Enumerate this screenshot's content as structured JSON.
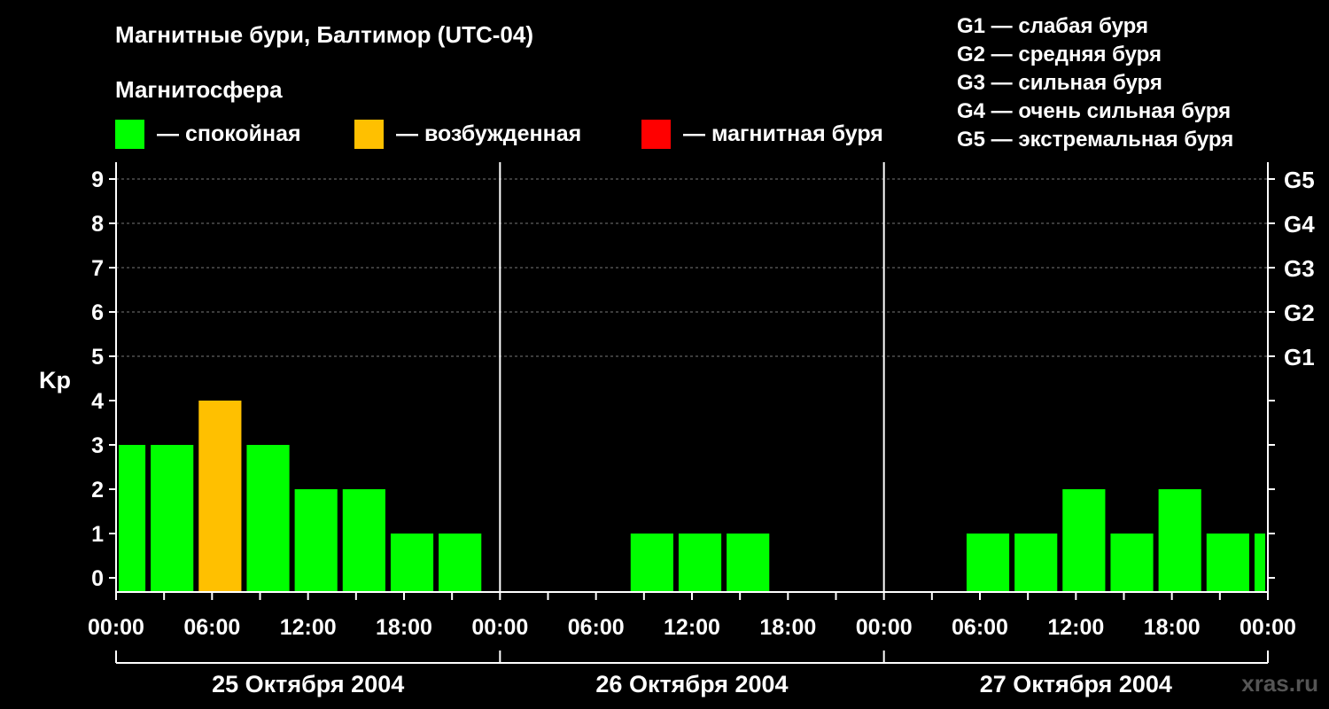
{
  "title": "Магнитные бури, Балтимор (UTC-04)",
  "subtitle": "Магнитосфера",
  "legend": [
    {
      "label": "— спокойная",
      "color": "#00ff00"
    },
    {
      "label": "— возбужденная",
      "color": "#ffc000"
    },
    {
      "label": "— магнитная буря",
      "color": "#ff0000"
    }
  ],
  "g_scale": [
    {
      "label": "G1 — слабая буря"
    },
    {
      "label": "G2 — средняя буря"
    },
    {
      "label": "G3 — сильная буря"
    },
    {
      "label": "G4 — очень сильная буря"
    },
    {
      "label": "G5 — экстремальная буря"
    }
  ],
  "watermark": "xras.ru",
  "chart_data": {
    "type": "bar",
    "ylabel": "Kp",
    "ylim": [
      0,
      9
    ],
    "y_ticks": [
      "0",
      "1",
      "2",
      "3",
      "4",
      "5",
      "6",
      "7",
      "8",
      "9"
    ],
    "right_ticks": [
      {
        "value": 5,
        "label": "G1"
      },
      {
        "value": 6,
        "label": "G2"
      },
      {
        "value": 7,
        "label": "G3"
      },
      {
        "value": 8,
        "label": "G4"
      },
      {
        "value": 9,
        "label": "G5"
      }
    ],
    "x_hour_labels": [
      "00:00",
      "06:00",
      "12:00",
      "18:00",
      "00:00",
      "06:00",
      "12:00",
      "18:00",
      "00:00",
      "06:00",
      "12:00",
      "18:00",
      "00:00"
    ],
    "days": [
      "25 Октября 2004",
      "26 Октября 2004",
      "27 Октября 2004"
    ],
    "colors": {
      "quiet": "#00ff00",
      "active": "#ffc000",
      "storm": "#ff0000"
    },
    "bars": [
      {
        "start": "25 Октября 2004 00:00",
        "end": "25 Октября 2004 02:00",
        "kp": 3,
        "state": "quiet"
      },
      {
        "start": "25 Октября 2004 02:00",
        "end": "25 Октября 2004 05:00",
        "kp": 3,
        "state": "quiet"
      },
      {
        "start": "25 Октября 2004 05:00",
        "end": "25 Октября 2004 08:00",
        "kp": 4,
        "state": "active"
      },
      {
        "start": "25 Октября 2004 08:00",
        "end": "25 Октября 2004 11:00",
        "kp": 3,
        "state": "quiet"
      },
      {
        "start": "25 Октября 2004 11:00",
        "end": "25 Октября 2004 14:00",
        "kp": 2,
        "state": "quiet"
      },
      {
        "start": "25 Октября 2004 14:00",
        "end": "25 Октября 2004 17:00",
        "kp": 2,
        "state": "quiet"
      },
      {
        "start": "25 Октября 2004 17:00",
        "end": "25 Октября 2004 20:00",
        "kp": 1,
        "state": "quiet"
      },
      {
        "start": "25 Октября 2004 20:00",
        "end": "25 Октября 2004 23:00",
        "kp": 1,
        "state": "quiet"
      },
      {
        "start": "26 Октября 2004 08:00",
        "end": "26 Октября 2004 11:00",
        "kp": 1,
        "state": "quiet"
      },
      {
        "start": "26 Октября 2004 11:00",
        "end": "26 Октября 2004 14:00",
        "kp": 1,
        "state": "quiet"
      },
      {
        "start": "26 Октября 2004 14:00",
        "end": "26 Октября 2004 17:00",
        "kp": 1,
        "state": "quiet"
      },
      {
        "start": "27 Октября 2004 05:00",
        "end": "27 Октября 2004 08:00",
        "kp": 1,
        "state": "quiet"
      },
      {
        "start": "27 Октября 2004 08:00",
        "end": "27 Октября 2004 11:00",
        "kp": 1,
        "state": "quiet"
      },
      {
        "start": "27 Октября 2004 11:00",
        "end": "27 Октября 2004 14:00",
        "kp": 2,
        "state": "quiet"
      },
      {
        "start": "27 Октября 2004 14:00",
        "end": "27 Октября 2004 17:00",
        "kp": 1,
        "state": "quiet"
      },
      {
        "start": "27 Октября 2004 17:00",
        "end": "27 Октября 2004 20:00",
        "kp": 2,
        "state": "quiet"
      },
      {
        "start": "27 Октября 2004 20:00",
        "end": "27 Октября 2004 23:00",
        "kp": 1,
        "state": "quiet"
      },
      {
        "start": "27 Октября 2004 23:00",
        "end": "28 Октября 2004 00:00",
        "kp": 1,
        "state": "quiet"
      }
    ]
  }
}
